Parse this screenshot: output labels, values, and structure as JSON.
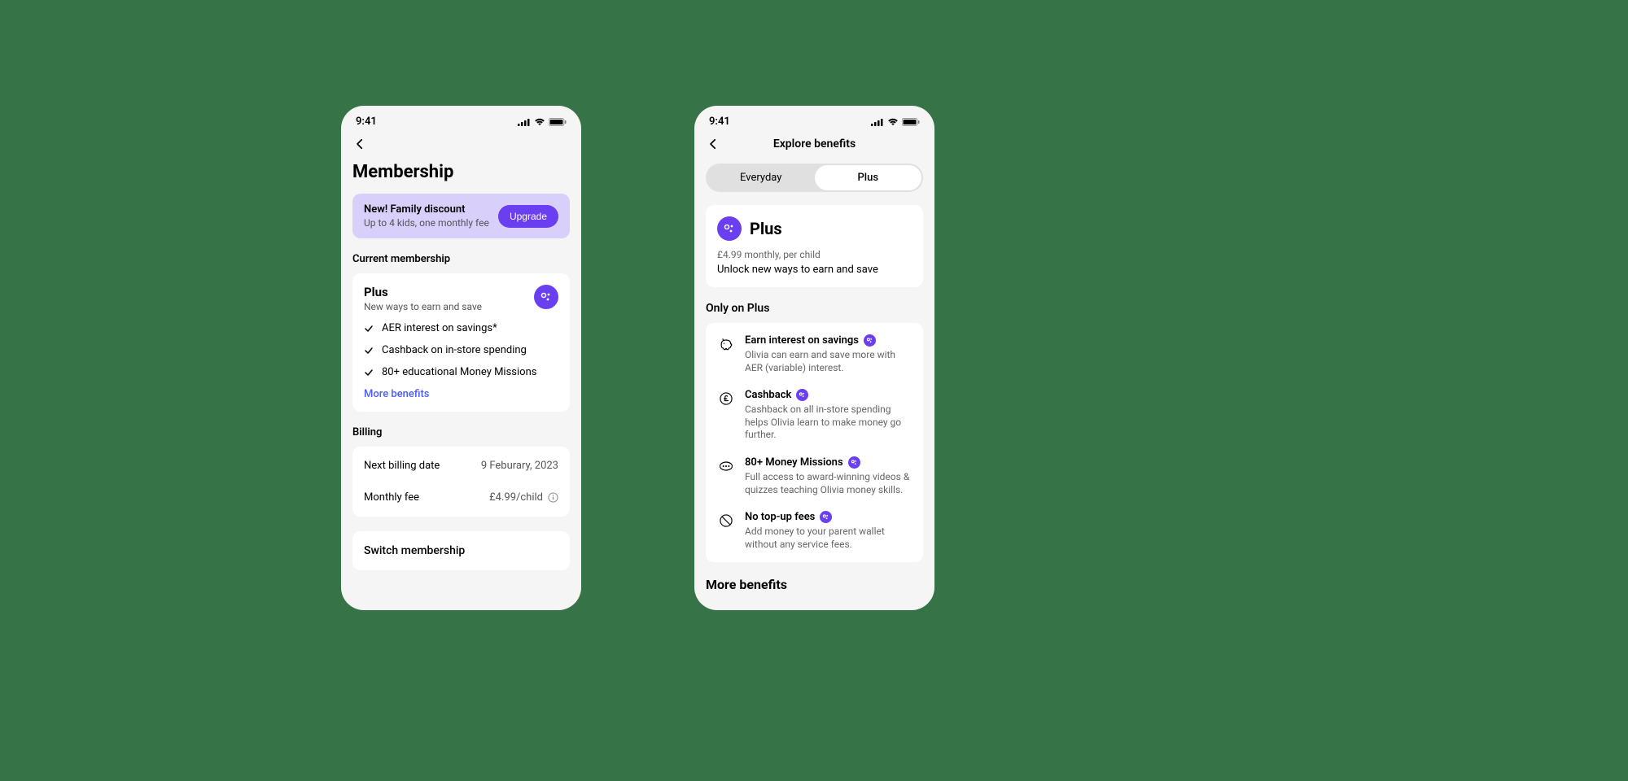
{
  "status": {
    "time": "9:41"
  },
  "left": {
    "title": "Membership",
    "banner": {
      "title": "New! Family discount",
      "sub": "Up to 4 kids, one monthly fee",
      "cta": "Upgrade"
    },
    "current_label": "Current membership",
    "plan": {
      "name": "Plus",
      "sub": "New ways to earn and save",
      "features": [
        "AER interest on savings*",
        "Cashback on in-store spending",
        "80+ educational Money Missions"
      ],
      "more_link": "More benefits"
    },
    "billing_label": "Billing",
    "billing": {
      "next_label": "Next billing date",
      "next_value": "9 Feburary, 2023",
      "fee_label": "Monthly fee",
      "fee_value": "£4.99/child"
    },
    "switch_label": "Switch membership"
  },
  "right": {
    "title": "Explore benefits",
    "tabs": {
      "everyday": "Everyday",
      "plus": "Plus"
    },
    "hero": {
      "name": "Plus",
      "price": "£4.99 monthly, per child",
      "desc": "Unlock new ways to earn and save"
    },
    "only_label": "Only on Plus",
    "benefits": [
      {
        "title": "Earn interest on savings",
        "desc": "Olivia can earn and save more with AER (variable) interest."
      },
      {
        "title": "Cashback",
        "desc": "Cashback on all in-store spending helps Olivia learn to make money go further."
      },
      {
        "title": "80+ Money Missions",
        "desc": "Full access to award-winning videos & quizzes teaching Olivia money skills."
      },
      {
        "title": "No top-up fees",
        "desc": "Add money to your parent wallet without any service fees."
      }
    ],
    "more_label": "More benefits"
  }
}
